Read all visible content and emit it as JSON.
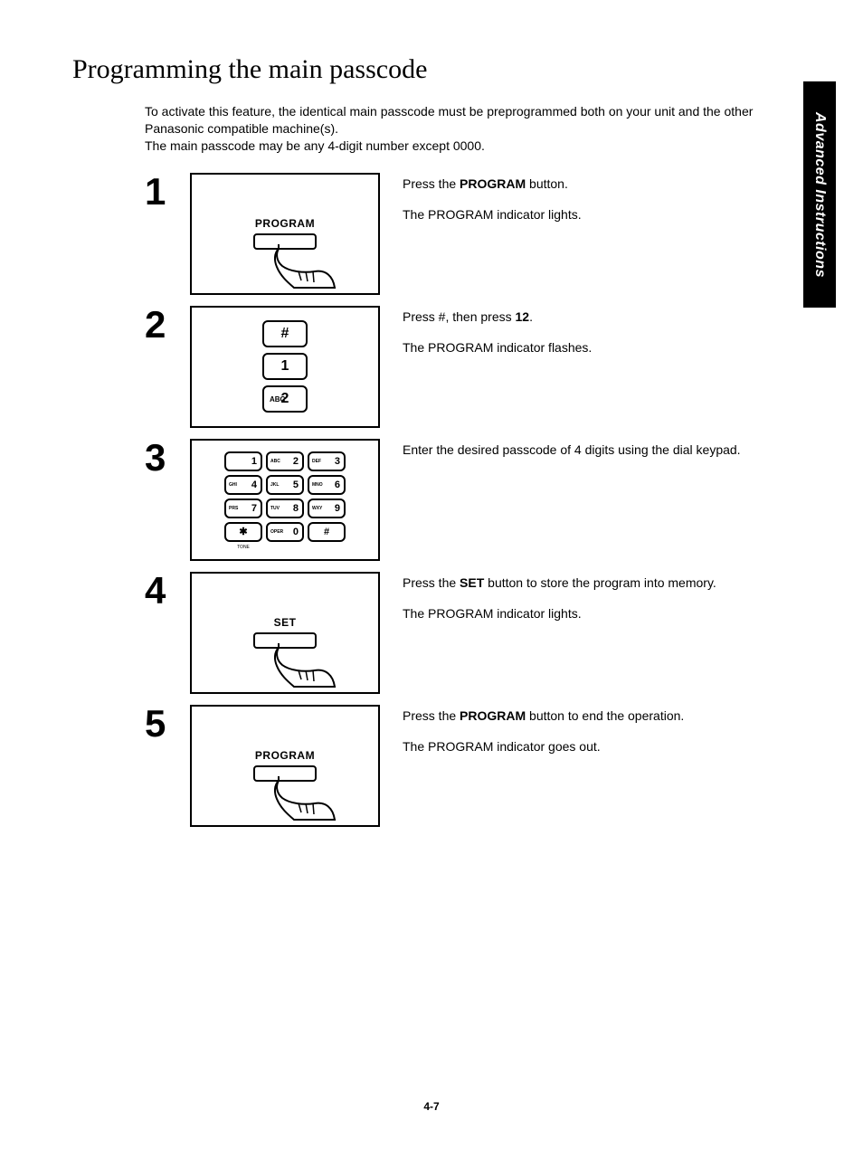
{
  "title": "Programming the main passcode",
  "intro_line1": "To activate this feature, the identical main passcode must be preprogrammed both on your unit and the other Panasonic compatible machine(s).",
  "intro_line2": "The main passcode may be any 4-digit number except 0000.",
  "side_tab": "Advanced Instructions",
  "page_number": "4-7",
  "steps": {
    "s1": {
      "num": "1",
      "diagram_label": "PROGRAM",
      "line1a": "Press the ",
      "line1b": "PROGRAM",
      "line1c": " button.",
      "line2": "The PROGRAM indicator lights."
    },
    "s2": {
      "num": "2",
      "key_hash": "#",
      "key_1": "1",
      "key_2_sub": "ABC",
      "key_2": "2",
      "line1a": "Press #, then press ",
      "line1b": "12",
      "line1c": ".",
      "line2": "The PROGRAM indicator flashes."
    },
    "s3": {
      "num": "3",
      "keys": {
        "k1": "1",
        "k2s": "ABC",
        "k2": "2",
        "k3s": "DEF",
        "k3": "3",
        "k4s": "GHI",
        "k4": "4",
        "k5s": "JKL",
        "k5": "5",
        "k6s": "MNO",
        "k6": "6",
        "k7s": "PRS",
        "k7": "7",
        "k8s": "TUV",
        "k8": "8",
        "k9s": "WXY",
        "k9": "9",
        "kstar": "✱",
        "k0s": "OPER",
        "k0": "0",
        "khash": "#"
      },
      "tone": "TONE",
      "line1": "Enter the desired passcode of 4 digits using the dial keypad."
    },
    "s4": {
      "num": "4",
      "diagram_label": "SET",
      "line1a": "Press the ",
      "line1b": "SET",
      "line1c": " button to store the program into memory.",
      "line2": "The PROGRAM indicator lights."
    },
    "s5": {
      "num": "5",
      "diagram_label": "PROGRAM",
      "line1a": "Press the ",
      "line1b": "PROGRAM",
      "line1c": " button to end the operation.",
      "line2": "The PROGRAM indicator goes out."
    }
  }
}
